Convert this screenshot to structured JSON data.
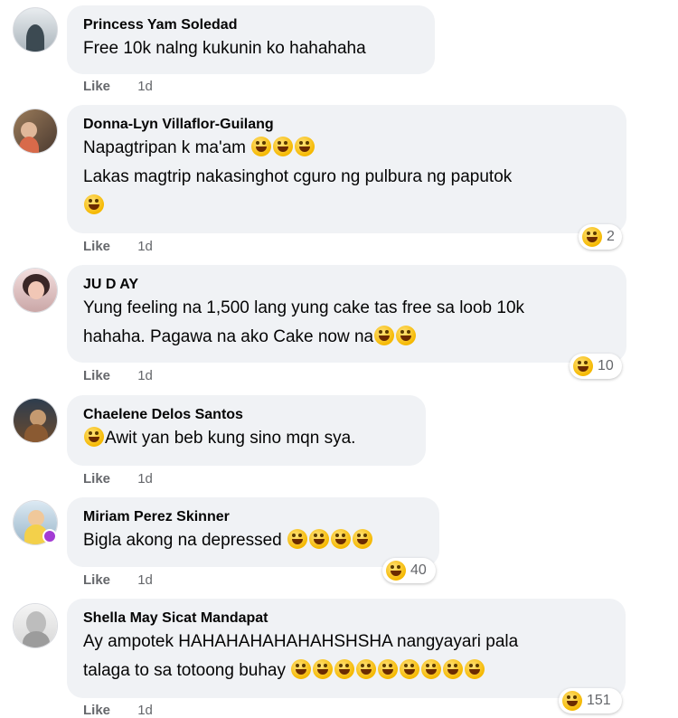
{
  "comments": [
    {
      "author": "Princess Yam Soledad",
      "lines": [
        "Free 10k nalng kukunin ko hahahaha"
      ],
      "like": "Like",
      "time": "1d"
    },
    {
      "author": "Donna-Lyn Villaflor-Guilang",
      "lines": [
        "Napagtripan k ma'am",
        "Lakas magtrip nakasinghot cguro ng pulbura ng paputok"
      ],
      "like": "Like",
      "time": "1d",
      "reaction_icon": "laughing-emoji-icon",
      "reaction_count": "2"
    },
    {
      "author": "JU D AY",
      "lines": [
        "Yung feeling na 1,500 lang yung cake tas free sa loob 10k",
        "hahaha. Pagawa na ako Cake now na"
      ],
      "like": "Like",
      "time": "1d",
      "reaction_icon": "laughing-emoji-icon",
      "reaction_count": "10"
    },
    {
      "author": "Chaelene Delos Santos",
      "lines": [
        "Awit yan beb kung sino mqn sya."
      ],
      "like": "Like",
      "time": "1d"
    },
    {
      "author": "Miriam Perez Skinner",
      "lines": [
        "Bigla akong na depressed"
      ],
      "like": "Like",
      "time": "1d",
      "reaction_icon": "laughing-emoji-icon",
      "reaction_count": "40"
    },
    {
      "author": "Shella May Sicat Mandapat",
      "lines": [
        "Ay ampotek HAHAHAHAHAHAHSHSHA nangyayari pala",
        "talaga to sa totoong buhay"
      ],
      "like": "Like",
      "time": "1d",
      "reaction_icon": "laughing-emoji-icon",
      "reaction_count": "151"
    }
  ],
  "colors": {
    "bubble": "#f0f2f5",
    "meta_text": "#65676b",
    "reaction_emoji": "#f5b800",
    "online_badge": "#a33bd4"
  }
}
